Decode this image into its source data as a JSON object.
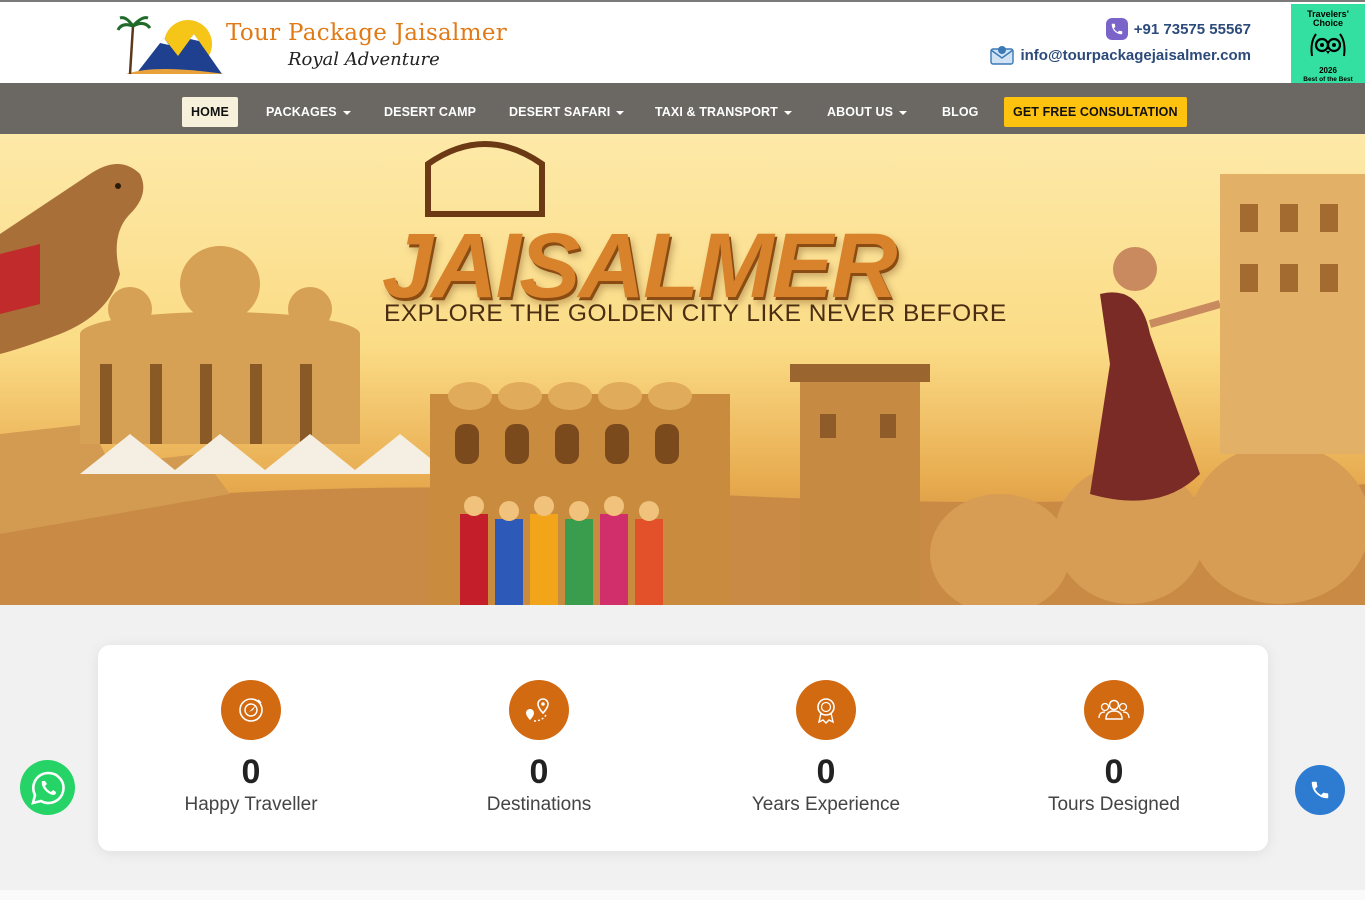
{
  "header": {
    "brand_title": "Tour Package Jaisalmer",
    "brand_subtitle": "Royal Adventure",
    "phone": "+91 73575 55567",
    "email": "info@tourpackagejaisalmer.com",
    "badge": {
      "line1": "Travelers'",
      "line2": "Choice",
      "year": "2026",
      "caption": "Best of the Best",
      "color": "#34e0a1"
    }
  },
  "nav": {
    "items": [
      {
        "label": "HOME",
        "dropdown": false
      },
      {
        "label": "PACKAGES",
        "dropdown": true
      },
      {
        "label": "DESERT CAMP",
        "dropdown": false
      },
      {
        "label": "DESERT SAFARI",
        "dropdown": true
      },
      {
        "label": "TAXI & TRANSPORT",
        "dropdown": true
      },
      {
        "label": "ABOUT US",
        "dropdown": true
      },
      {
        "label": "BLOG",
        "dropdown": false
      }
    ],
    "cta": "GET FREE CONSULTATION",
    "active": "HOME"
  },
  "hero": {
    "title": "JAISALMER",
    "tagline": "EXPLORE THE GOLDEN CITY LIKE NEVER BEFORE"
  },
  "stats": [
    {
      "value": "0",
      "label": "Happy Traveller",
      "icon": "compass-icon"
    },
    {
      "value": "0",
      "label": "Destinations",
      "icon": "map-pin-icon"
    },
    {
      "value": "0",
      "label": "Years Experience",
      "icon": "award-icon"
    },
    {
      "value": "0",
      "label": "Tours Designed",
      "icon": "group-icon"
    }
  ],
  "colors": {
    "brand_orange": "#e07a16",
    "nav_bg": "#6b6863",
    "cta_yellow": "#ffc20e",
    "stat_icon_bg": "#d26a12",
    "whatsapp": "#25d366",
    "call": "#2e7cd1"
  }
}
